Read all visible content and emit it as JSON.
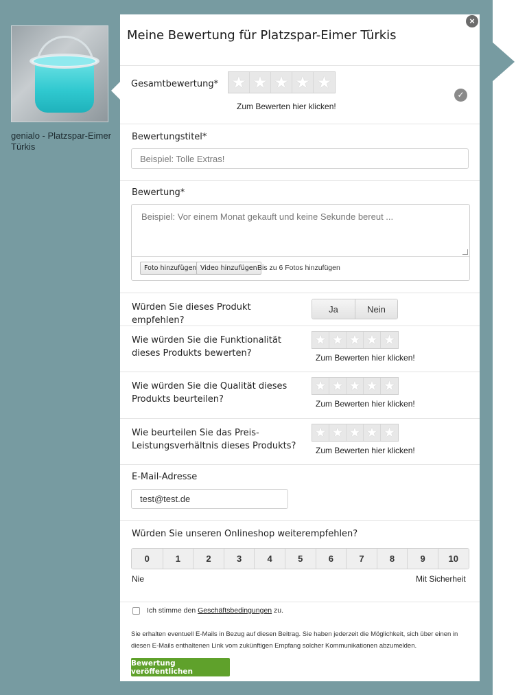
{
  "product": {
    "name": "genialo - Platzspar-Eimer Türkis"
  },
  "form": {
    "title": "Meine Bewertung für Platzspar-Eimer Türkis",
    "close_glyph": "×",
    "overall": {
      "label": "Gesamtbewertung*",
      "hint": "Zum Bewerten hier klicken!",
      "rating": 0,
      "max": 5
    },
    "review_title": {
      "label": "Bewertungstitel*",
      "placeholder": "Beispiel: Tolle Extras!"
    },
    "review_body": {
      "label": "Bewertung*",
      "placeholder": "Beispiel: Vor einem Monat gekauft und keine Sekunde bereut ...",
      "add_photo": "Foto hinzufügen",
      "add_video": "Video hinzufügen",
      "photo_note": "Bis zu 6 Fotos hinzufügen"
    },
    "recommend": {
      "label": "Würden Sie dieses Produkt empfehlen?",
      "yes": "Ja",
      "no": "Nein"
    },
    "functionality": {
      "label": "Wie würden Sie die Funktionalität dieses Produkts bewerten?",
      "hint": "Zum Bewerten hier klicken!"
    },
    "quality": {
      "label": "Wie würden Sie die Qualität dieses Produkts beurteilen?",
      "hint": "Zum Bewerten hier klicken!"
    },
    "value": {
      "label": "Wie beurteilen Sie das Preis-Leistungsverhältnis dieses Produkts?",
      "hint": "Zum Bewerten hier klicken!"
    },
    "email": {
      "label": "E-Mail-Adresse",
      "value": "test@test.de"
    },
    "nps": {
      "label": "Würden Sie unseren Onlineshop weiterempfehlen?",
      "options": [
        "0",
        "1",
        "2",
        "3",
        "4",
        "5",
        "6",
        "7",
        "8",
        "9",
        "10"
      ],
      "low_label": "Nie",
      "high_label": "Mit Sicherheit"
    },
    "terms": {
      "prefix": "Ich stimme den",
      "link": "Geschäftsbedingungen",
      "suffix": "zu."
    },
    "disclaimer": "Sie erhalten eventuell E-Mails in Bezug auf diesen Beitrag. Sie haben jederzeit die Möglichkeit, sich über einen in diesen E-Mails enthaltenen Link vom zukünftigen Empfang solcher Kommunikationen abzumelden.",
    "submit": "Bewertung veröffentlichen"
  },
  "colors": {
    "backdrop": "#779ba1",
    "submit": "#5fa12b"
  },
  "icons": {
    "star": "★",
    "check": "✓"
  }
}
